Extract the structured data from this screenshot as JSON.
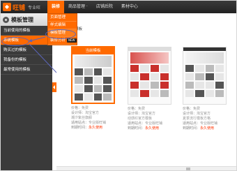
{
  "app": {
    "logo_text": "旺铺",
    "logo_sub": "专业旺"
  },
  "topnav": {
    "items": [
      {
        "label": "装修"
      },
      {
        "label": "商品管理 ·"
      },
      {
        "label": "店铺后院"
      },
      {
        "label": "素材中心"
      }
    ]
  },
  "dropdown": {
    "items": [
      {
        "label": "页面管理"
      },
      {
        "label": "样式编辑"
      },
      {
        "label": "模板管理"
      },
      {
        "label": "装修分析",
        "badge": "NEW"
      }
    ]
  },
  "sidebar": {
    "title": "模板管理",
    "items": [
      {
        "label": "当前使用的模板"
      },
      {
        "label": "系统模板"
      },
      {
        "label": "购买过的模板"
      },
      {
        "label": "我备份的模板"
      },
      {
        "label": "最常使用的模板"
      }
    ]
  },
  "breadcrumb": "模板",
  "cards": [
    {
      "badge": "当前模板",
      "price_label": "价格：",
      "price": "免费",
      "designer_label": "设计师：",
      "designer": "淘宝官方",
      "name": "潮汐紫丝旗舰",
      "suit_label": "适用站点：",
      "suit": "专业版旺铺",
      "expire_label": "到期时间：",
      "expire": "永久使用"
    },
    {
      "badge": "",
      "price_label": "价格：",
      "price": "免费",
      "designer_label": "设计师：",
      "designer": "淘宝官方",
      "name": "动感红官方模板",
      "suit_label": "适用站点：",
      "suit": "专业版旺铺",
      "expire_label": "到期时间：",
      "expire": "永久使用"
    },
    {
      "badge": "",
      "price_label": "价格：",
      "price": "免费",
      "designer_label": "设计师：",
      "designer": "淘宝官方",
      "name": "夏季流行模板方格",
      "suit_label": "适用站点：",
      "suit": "专业版旺铺",
      "expire_label": "到期时间：",
      "expire": "永久使用"
    }
  ],
  "colors": {
    "accent": "#ff6a00",
    "sidebar": "#3a3a3a",
    "annotation": "#5a64b8"
  },
  "icons": [
    "gear-icon",
    "collapse-arrow-icon"
  ]
}
